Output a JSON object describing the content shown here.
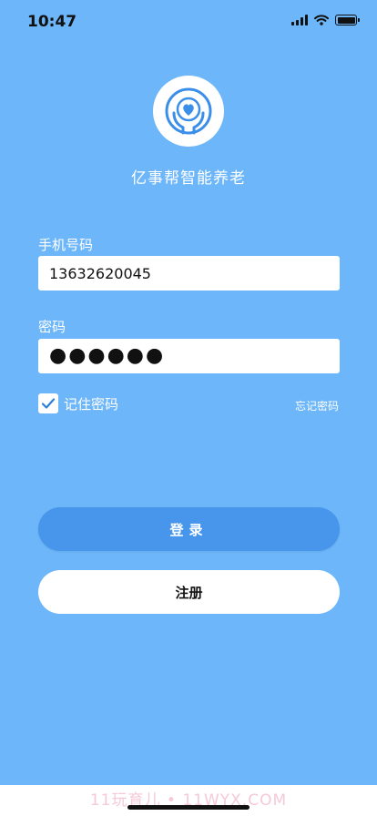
{
  "status": {
    "time": "10:47"
  },
  "app": {
    "title": "亿事帮智能养老"
  },
  "phone": {
    "label": "手机号码",
    "value": "13632620045"
  },
  "password": {
    "label": "密码",
    "masked": "●●●●●●"
  },
  "remember": {
    "label": "记住密码",
    "checked": true
  },
  "forgot_label": "忘记密码",
  "buttons": {
    "login": "登录",
    "register": "注册"
  },
  "watermark": "11玩育儿 • 11WYX.COM",
  "colors": {
    "background": "#6cb6f9",
    "login_button": "#4796ec",
    "accent": "#3b8fe8"
  },
  "icons": {
    "logo": "heart-in-hands-icon",
    "checkbox": "checkmark-icon",
    "signal": "signal-icon",
    "wifi": "wifi-icon",
    "battery": "battery-icon"
  }
}
